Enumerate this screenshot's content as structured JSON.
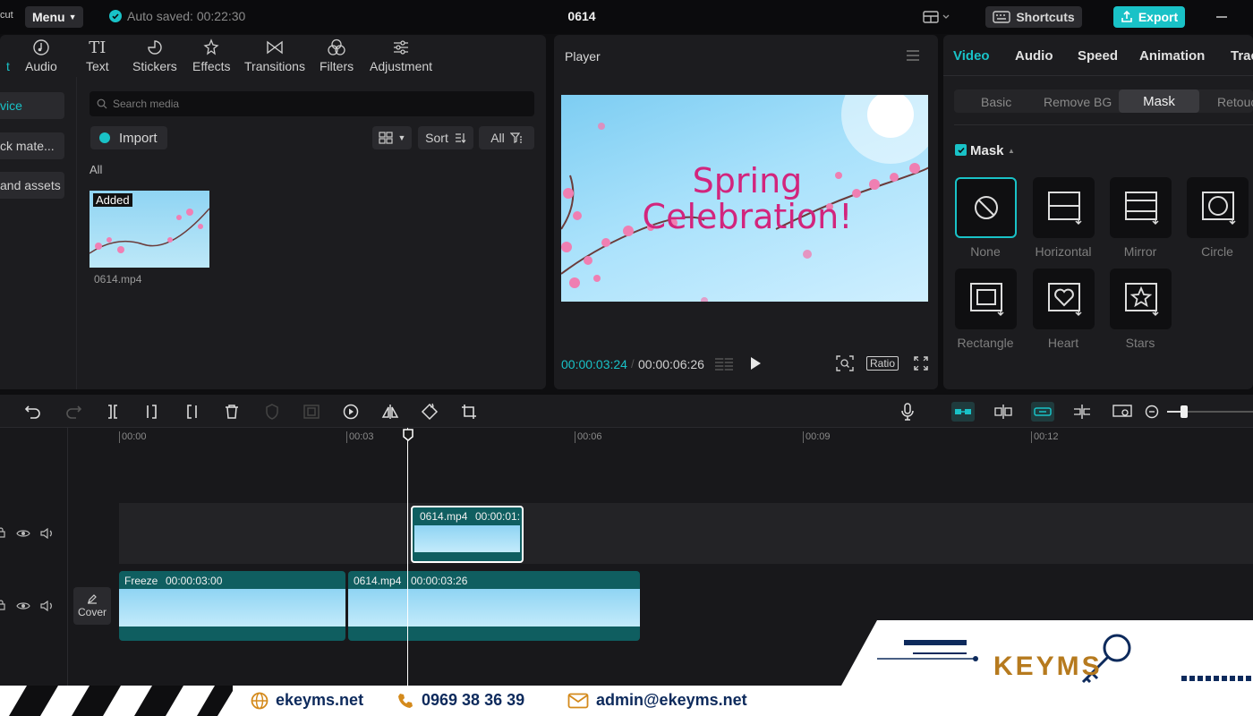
{
  "titlebar": {
    "logo_fragment": "cut",
    "menu_label": "Menu",
    "autosave_text": "Auto saved: 00:22:30",
    "project_title": "0614",
    "shortcuts_label": "Shortcuts",
    "export_label": "Export"
  },
  "media_toolbar": [
    {
      "label": "t"
    },
    {
      "label": "Audio"
    },
    {
      "label": "Text"
    },
    {
      "label": "Stickers"
    },
    {
      "label": "Effects"
    },
    {
      "label": "Transitions"
    },
    {
      "label": "Filters"
    },
    {
      "label": "Adjustment"
    }
  ],
  "media_sidebar": [
    {
      "label": "vice"
    },
    {
      "label": "ck mate..."
    },
    {
      "label": "and assets"
    }
  ],
  "media": {
    "search_placeholder": "Search media",
    "import_label": "Import",
    "sort_label": "Sort",
    "all_filter_label": "All",
    "section_label": "All",
    "items": [
      {
        "badge": "Added",
        "filename": "0614.mp4"
      }
    ]
  },
  "player": {
    "title": "Player",
    "video_text_line1": "Spring",
    "video_text_line2": "Celebration!",
    "timecode_current": "00:00:03:24",
    "timecode_total": "00:00:06:26",
    "ratio_label": "Ratio"
  },
  "properties": {
    "tabs": [
      "Video",
      "Audio",
      "Speed",
      "Animation",
      "Trac"
    ],
    "sub_tabs": [
      "Basic",
      "Remove BG",
      "Mask",
      "Retouc"
    ],
    "active_sub_tab": "Mask",
    "mask_section_label": "Mask",
    "masks": [
      {
        "name": "None"
      },
      {
        "name": "Horizontal"
      },
      {
        "name": "Mirror"
      },
      {
        "name": "Circle"
      },
      {
        "name": "Rectangle"
      },
      {
        "name": "Heart"
      },
      {
        "name": "Stars"
      }
    ]
  },
  "timeline": {
    "ruler": [
      "00:00",
      "00:03",
      "00:06",
      "00:09",
      "00:12"
    ],
    "overlay_clip": {
      "name": "0614.mp4",
      "duration": "00:00:01:"
    },
    "main_clips": [
      {
        "name": "Freeze",
        "duration": "00:00:03:00"
      },
      {
        "name": "0614.mp4",
        "duration": "00:00:03:26"
      }
    ],
    "cover_label": "Cover"
  },
  "footer": {
    "website": "ekeyms.net",
    "phone": "0969 38 36 39",
    "email": "admin@ekeyms.net",
    "logo_text": "KEYMS"
  },
  "colors": {
    "accent": "#19c2c7",
    "panel": "#1c1c1f",
    "clip": "#0f5e60",
    "video_text": "#d2257d"
  }
}
